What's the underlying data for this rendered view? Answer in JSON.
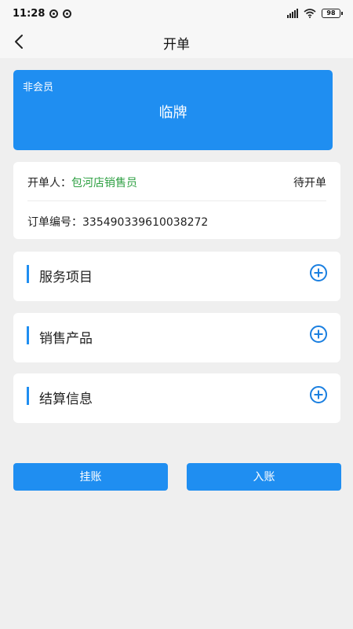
{
  "status_bar": {
    "time": "11:28",
    "battery": "98"
  },
  "nav": {
    "title": "开单"
  },
  "member_card": {
    "member_type": "非会员",
    "plate": "临牌"
  },
  "order_info": {
    "operator_label": "开单人：",
    "operator_name": "包河店销售员",
    "status": "待开单",
    "order_no_label": "订单编号：",
    "order_no": "335490339610038272"
  },
  "sections": [
    {
      "title": "服务项目"
    },
    {
      "title": "销售产品"
    },
    {
      "title": "结算信息"
    }
  ],
  "actions": {
    "hang_label": "挂账",
    "post_label": "入账"
  },
  "colors": {
    "primary": "#1f8ef1",
    "operator_name": "#2ea043",
    "background": "#efefef"
  }
}
